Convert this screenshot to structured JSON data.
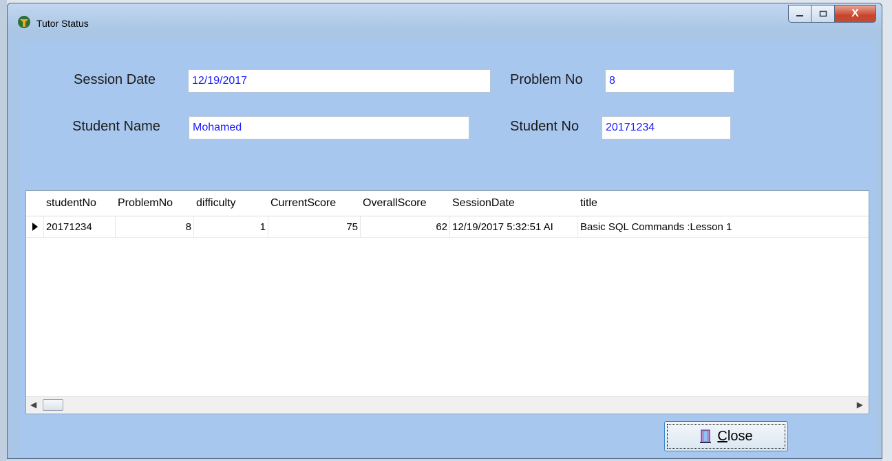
{
  "window": {
    "title": "Tutor Status",
    "controls": {
      "minimize": "—",
      "maximize": "□",
      "close": "X"
    }
  },
  "form": {
    "session_date_label": "Session Date",
    "session_date_value": "12/19/2017",
    "problem_no_label": "Problem No",
    "problem_no_value": "8",
    "student_name_label": "Student Name",
    "student_name_value": "Mohamed",
    "student_no_label": "Student No",
    "student_no_value": "20171234"
  },
  "grid": {
    "columns": [
      "studentNo",
      "ProblemNo",
      "difficulty",
      "CurrentScore",
      "OverallScore",
      "SessionDate",
      "title"
    ],
    "rows": [
      [
        "20171234",
        "8",
        "1",
        "75",
        "62",
        "12/19/2017 5:32:51 AI",
        "Basic SQL Commands :Lesson 1"
      ]
    ]
  },
  "buttons": {
    "close_label_first": "C",
    "close_label_rest": "lose"
  }
}
